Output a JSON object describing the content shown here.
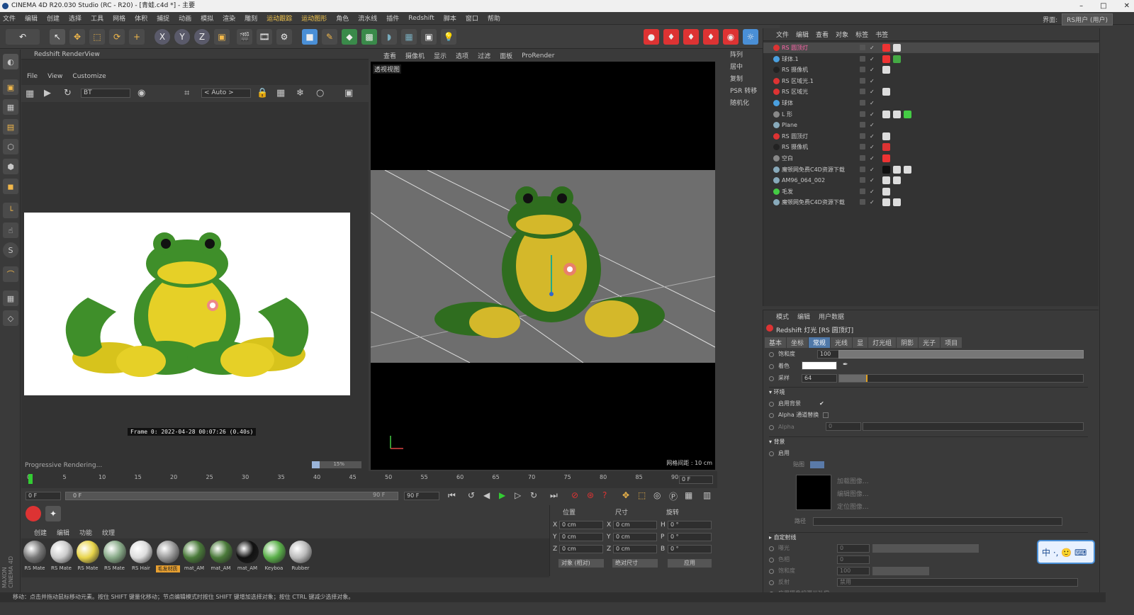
{
  "window": {
    "title": "CINEMA 4D R20.030 Studio (RC - R20) - [青蛙.c4d *] - 主要",
    "controls": [
      "–",
      "□",
      "✕"
    ]
  },
  "menubar": {
    "items": [
      "文件",
      "编辑",
      "创建",
      "选择",
      "工具",
      "网格",
      "体积",
      "捕捉",
      "动画",
      "模拟",
      "渲染",
      "雕刻",
      "运动跟踪",
      "运动图形",
      "角色",
      "流水线",
      "插件",
      "Redshift",
      "脚本",
      "窗口",
      "帮助"
    ],
    "layout_label": "界面:",
    "layout_value": "RS用户 (用户)"
  },
  "renderview": {
    "title": "Redshift RenderView",
    "menu": [
      "File",
      "View",
      "Customize"
    ],
    "aov": "BT",
    "auto": "< Auto >",
    "frame_caption": "Frame  0:  2022-04-28  00:07:26  (0.40s)",
    "status": "Progressive Rendering...",
    "progress_percent": 15,
    "progress_label": "15%"
  },
  "viewport": {
    "tabs": [
      "查看",
      "摄像机",
      "显示",
      "选项",
      "过滤",
      "面板",
      "ProRender"
    ],
    "label": "透视视图",
    "grid": "网格间距 : 10 cm"
  },
  "side_tools": [
    "阵列",
    "居中",
    "复制",
    "PSR 转移",
    "随机化"
  ],
  "object_manager": {
    "tabs": [
      "文件",
      "编辑",
      "查看",
      "对象",
      "标签",
      "书签"
    ],
    "objects": [
      {
        "name": "RS 圆顶灯",
        "color": "#d33",
        "highlight": true
      },
      {
        "name": "球体.1",
        "color": "#4aa0e0"
      },
      {
        "name": "RS 摄像机",
        "color": "#222"
      },
      {
        "name": "RS 区域光.1",
        "color": "#d33"
      },
      {
        "name": "RS 区域光",
        "color": "#d33"
      },
      {
        "name": "球体",
        "color": "#4aa0e0"
      },
      {
        "name": "L 形",
        "color": "#888"
      },
      {
        "name": "Plane",
        "color": "#8ab"
      },
      {
        "name": "RS 圆顶灯",
        "color": "#d33"
      },
      {
        "name": "RS 摄像机",
        "color": "#222"
      },
      {
        "name": "空白",
        "color": "#888"
      },
      {
        "name": "魔顿网免费C4D资源下载",
        "color": "#8ab"
      },
      {
        "name": "AM96_064_002",
        "color": "#8ab"
      },
      {
        "name": "毛发",
        "color": "#4c4"
      },
      {
        "name": "魔顿网免费C4D资源下载",
        "color": "#8ab"
      }
    ]
  },
  "attribute_manager": {
    "header": [
      "模式",
      "编辑",
      "用户数据"
    ],
    "title": "Redshift 灯光 [RS 圆顶灯]",
    "tabs": [
      "基本",
      "坐标",
      "常规",
      "光线",
      "显",
      "灯光组",
      "阴影",
      "光子",
      "项目"
    ],
    "active_tab": "常规",
    "saturation_label": "饱和度",
    "saturation_value": "100",
    "tint_label": "着色",
    "samples_label": "采样",
    "samples_value": "64",
    "env_section": "环境",
    "use_background": "启用背景",
    "alpha_replace": "Alpha 通道替换",
    "alpha_label": "Alpha",
    "alpha_value": "0",
    "bg_section": "背景",
    "bg_enable": "启用",
    "bg_mode": "贴图",
    "load_image": "加载图像...",
    "edit_image": "编辑图像...",
    "locate_image": "定位图像...",
    "path_label": "路径",
    "ray_section": "自定射线",
    "exposure": "曝光",
    "exposure_value": "0",
    "hue": "色相",
    "hue_value": "0",
    "saturation2": "饱和度",
    "saturation2_value": "100",
    "reflection": "反射",
    "reflection_value": "禁用",
    "camera_exposure": "应用摄像机曝光补偿"
  },
  "timeline": {
    "ticks": [
      "0",
      "5",
      "10",
      "15",
      "20",
      "25",
      "30",
      "35",
      "40",
      "45",
      "50",
      "55",
      "60",
      "65",
      "70",
      "75",
      "80",
      "85",
      "90"
    ],
    "end_frame": "0 F",
    "start": "0 F",
    "current": "0 F",
    "range_end": "90 F",
    "range_end2": "90 F"
  },
  "materials": {
    "tabs": [
      "创建",
      "编辑",
      "功能",
      "纹理"
    ],
    "items": [
      {
        "name": "RS Mate",
        "color": "#777"
      },
      {
        "name": "RS Mate",
        "color": "#ccc"
      },
      {
        "name": "RS Mate",
        "color": "#e8d44a"
      },
      {
        "name": "RS Mate",
        "color": "#8a8"
      },
      {
        "name": "RS Hair",
        "color": "#ddd"
      },
      {
        "name": "毛发材质",
        "color": "#999",
        "selected": true
      },
      {
        "name": "mat_AM",
        "color": "#4a7a3a"
      },
      {
        "name": "mat_AM",
        "color": "#4a7a3a"
      },
      {
        "name": "mat_AM",
        "color": "#111"
      },
      {
        "name": "Keyboa",
        "color": "#5bb04a"
      },
      {
        "name": "Rubber",
        "color": "#bbb"
      }
    ]
  },
  "coordinates": {
    "headers": [
      "位置",
      "尺寸",
      "旋转"
    ],
    "axes": [
      "X",
      "Y",
      "Z"
    ],
    "rot_axes": [
      "H",
      "P",
      "B"
    ],
    "pos": [
      "0 cm",
      "0 cm",
      "0 cm"
    ],
    "size": [
      "0 cm",
      "0 cm",
      "0 cm"
    ],
    "rot": [
      "0 °",
      "0 °",
      "0 °"
    ],
    "mode1": "对象 (相对)",
    "mode2": "绝对尺寸",
    "apply": "应用"
  },
  "status_text": "移动：点击并拖动鼠标移动元素。按住 SHIFT 键量化移动；节点编辑模式时按住 SHIFT 键增加选择对象；按住 CTRL 键减少选择对象。",
  "branding": "MAXON CINEMA 4D",
  "ime": "中 ·, 🙂 ⌨"
}
